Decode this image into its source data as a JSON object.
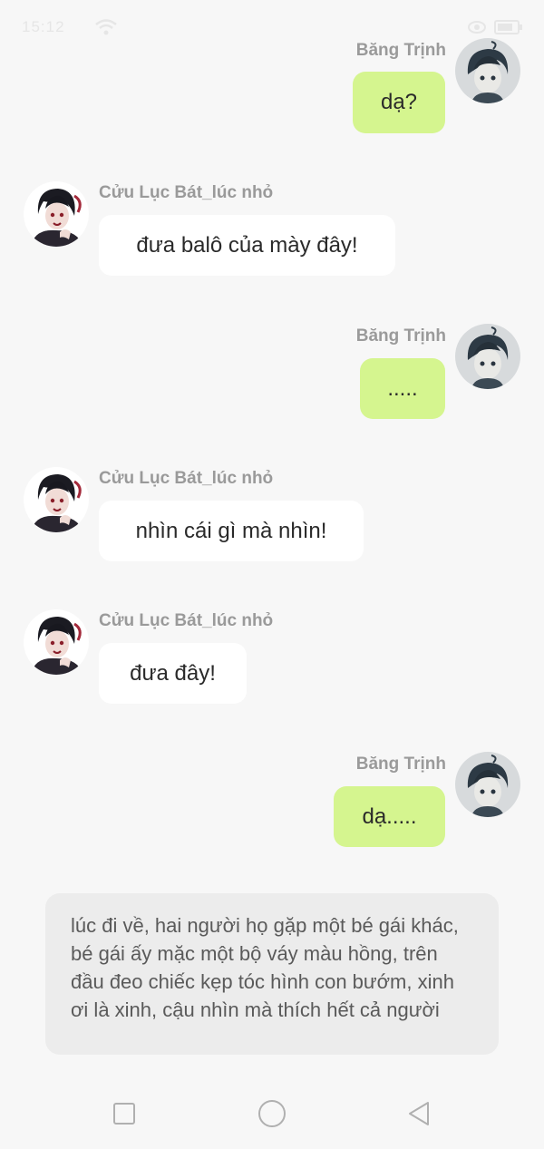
{
  "status_bar": {
    "time": "15:12",
    "wifi_icon": "wifi-icon",
    "right_icons": [
      "eye-icon",
      "battery-icon"
    ]
  },
  "messages": [
    {
      "sender": "Băng Trịnh",
      "side": "right",
      "text": "dạ?",
      "avatar": "avatar-bang-trinh"
    },
    {
      "sender": "Cửu Lục Bát_lúc nhỏ",
      "side": "left",
      "text": "đưa balô của mày đây!",
      "avatar": "avatar-cuu-luc-bat"
    },
    {
      "sender": "Băng Trịnh",
      "side": "right",
      "text": ".....",
      "avatar": "avatar-bang-trinh"
    },
    {
      "sender": "Cửu Lục Bát_lúc nhỏ",
      "side": "left",
      "text": "nhìn cái gì mà nhìn!",
      "avatar": "avatar-cuu-luc-bat"
    },
    {
      "sender": "Cửu Lục Bát_lúc nhỏ",
      "side": "left",
      "text": "đưa đây!",
      "avatar": "avatar-cuu-luc-bat"
    },
    {
      "sender": "Băng Trịnh",
      "side": "right",
      "text": "dạ.....",
      "avatar": "avatar-bang-trinh"
    }
  ],
  "narration": {
    "text": "lúc đi về, hai người họ gặp một bé gái khác, bé gái ấy mặc một bộ váy màu hồng, trên đầu đeo chiếc kẹp tóc hình con bướm, xinh ơi là xinh, cậu nhìn mà thích hết cả người"
  },
  "nav_bar": {
    "buttons": [
      "recents-square-icon",
      "home-circle-icon",
      "back-triangle-icon"
    ]
  },
  "colors": {
    "background": "#f7f7f7",
    "self_bubble": "#d5f58f",
    "other_bubble": "#ffffff",
    "sender_name": "#9a9a9a",
    "narration_bg": "#ececec"
  }
}
